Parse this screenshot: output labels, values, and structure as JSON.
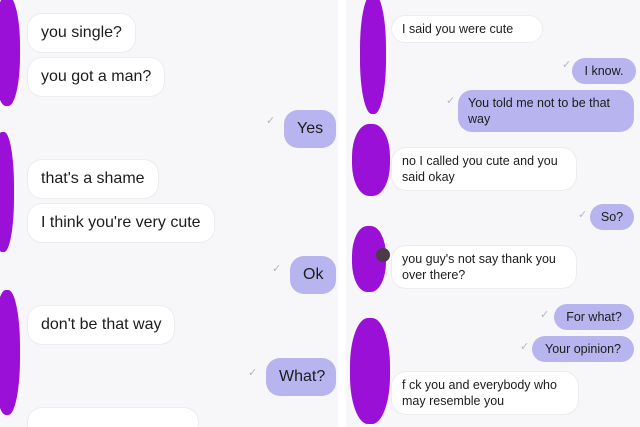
{
  "left_chat": {
    "messages": [
      {
        "dir": "in",
        "text": "you single?"
      },
      {
        "dir": "in",
        "text": "you got a man?"
      },
      {
        "dir": "out",
        "text": "Yes"
      },
      {
        "dir": "in",
        "text": "that's a shame"
      },
      {
        "dir": "in",
        "text": "I think you're very cute"
      },
      {
        "dir": "out",
        "text": "Ok"
      },
      {
        "dir": "in",
        "text": "don't be that way"
      },
      {
        "dir": "out",
        "text": "What?"
      }
    ]
  },
  "right_chat": {
    "messages": [
      {
        "dir": "in",
        "text": "I said you were cute"
      },
      {
        "dir": "out",
        "text": "I know."
      },
      {
        "dir": "out",
        "text": "You told me not to be that way"
      },
      {
        "dir": "in",
        "text": "no I called you cute and you said okay"
      },
      {
        "dir": "out",
        "text": "So?"
      },
      {
        "dir": "in",
        "text": "you guy's not say thank you over there?"
      },
      {
        "dir": "out",
        "text": "For what?"
      },
      {
        "dir": "out",
        "text": "Your opinion?"
      },
      {
        "dir": "in",
        "text": "f  ck you and everybody who may resemble you"
      }
    ]
  },
  "icons": {
    "seen": "seen-check-icon",
    "redaction": "purple-scribble"
  },
  "colors": {
    "outgoing_bubble": "#b7b4ef",
    "incoming_bubble": "#ffffff",
    "redaction": "#9a10d6",
    "background": "#f7f7f9"
  }
}
